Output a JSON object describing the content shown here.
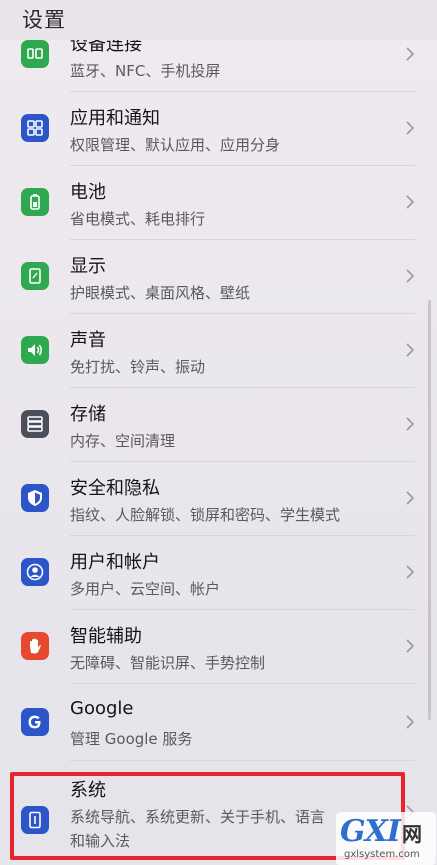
{
  "header": {
    "title": "设置"
  },
  "colors": {
    "blue_icon": "#2b55c9",
    "green_icon": "#2fa84f",
    "red_icon": "#e64a2e",
    "highlight": "#e8242a"
  },
  "items": [
    {
      "title": "设备连接",
      "subtitle": "蓝牙、NFC、手机投屏",
      "icon": "device-connection-icon"
    },
    {
      "title": "应用和通知",
      "subtitle": "权限管理、默认应用、应用分身",
      "icon": "apps-icon"
    },
    {
      "title": "电池",
      "subtitle": "省电模式、耗电排行",
      "icon": "battery-icon"
    },
    {
      "title": "显示",
      "subtitle": "护眼模式、桌面风格、壁纸",
      "icon": "display-icon"
    },
    {
      "title": "声音",
      "subtitle": "免打扰、铃声、振动",
      "icon": "sound-icon"
    },
    {
      "title": "存储",
      "subtitle": "内存、空间清理",
      "icon": "storage-icon"
    },
    {
      "title": "安全和隐私",
      "subtitle": "指纹、人脸解锁、锁屏和密码、学生模式",
      "icon": "security-icon"
    },
    {
      "title": "用户和帐户",
      "subtitle": "多用户、云空间、帐户",
      "icon": "user-icon"
    },
    {
      "title": "智能辅助",
      "subtitle": "无障碍、智能识屏、手势控制",
      "icon": "hand-icon"
    },
    {
      "title": "Google",
      "subtitle": "管理 Google 服务",
      "icon": "google-icon"
    },
    {
      "title": "系统",
      "subtitle": "系统导航、系统更新、关于手机、语言",
      "subtitle2": "和输入法",
      "icon": "system-icon"
    }
  ],
  "watermark": {
    "logo": "GXI",
    "net": "网",
    "url": "gxlsystem.com"
  }
}
